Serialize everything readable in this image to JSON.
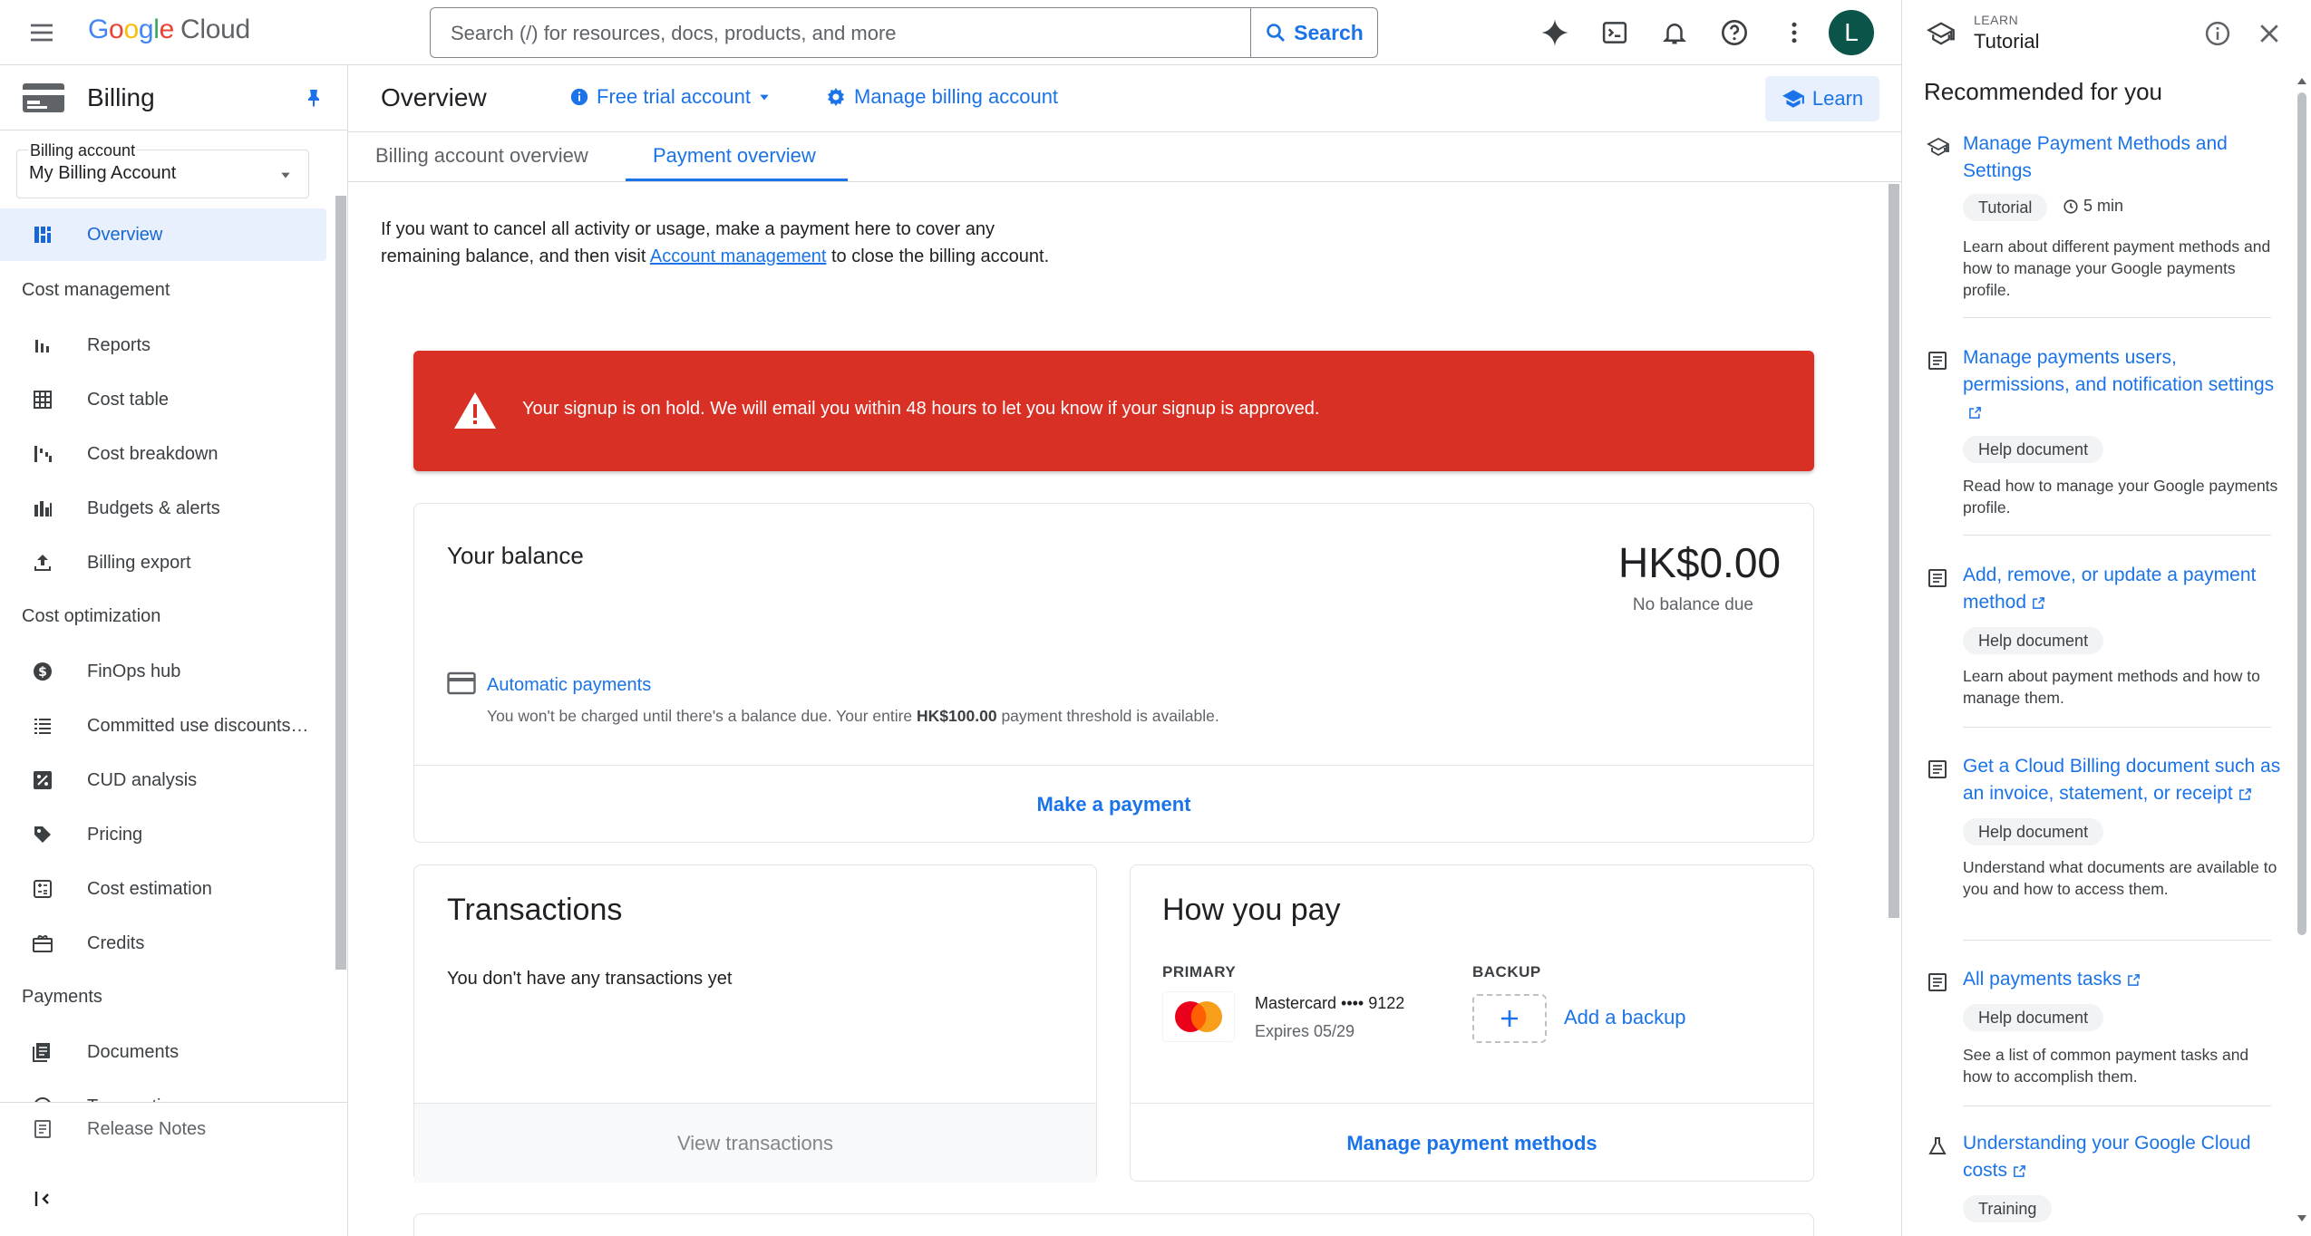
{
  "topbar": {
    "logo_google": "Google",
    "logo_cloud": "Cloud",
    "search_placeholder": "Search (/) for resources, docs, products, and more",
    "search_button": "Search",
    "avatar_initial": "L"
  },
  "billing_nav": {
    "title": "Billing",
    "account_label": "Billing account",
    "account_value": "My Billing Account",
    "overview": "Overview",
    "cost_management_heading": "Cost management",
    "cost_management": [
      "Reports",
      "Cost table",
      "Cost breakdown",
      "Budgets & alerts",
      "Billing export"
    ],
    "cost_optimization_heading": "Cost optimization",
    "cost_optimization": [
      "FinOps hub",
      "Committed use discounts…",
      "CUD analysis",
      "Pricing",
      "Cost estimation",
      "Credits"
    ],
    "payments_heading": "Payments",
    "payments": [
      "Documents",
      "Transactions"
    ],
    "release_notes": "Release Notes"
  },
  "page_header": {
    "title": "Overview",
    "account_type": "Free trial account",
    "manage_billing": "Manage billing account",
    "learn": "Learn"
  },
  "tabs": [
    "Billing account overview",
    "Payment overview"
  ],
  "intro": {
    "before_link": "If you want to cancel all activity or usage, make a payment here to cover any remaining balance, and then visit ",
    "link": "Account management",
    "after_link": " to close the billing account."
  },
  "alert": {
    "message": "Your signup is on hold. We will email you within 48 hours to let you know if your signup is approved."
  },
  "balance": {
    "title": "Your balance",
    "amount": "HK$0.00",
    "status": "No balance due",
    "autopay_link": "Automatic payments",
    "autopay_desc_before": "You won't be charged until there's a balance due. Your entire ",
    "autopay_threshold": "HK$100.00",
    "autopay_desc_after": " payment threshold is available.",
    "make_payment": "Make a payment"
  },
  "transactions": {
    "title": "Transactions",
    "empty": "You don't have any transactions yet",
    "view": "View transactions"
  },
  "how_you_pay": {
    "title": "How you pay",
    "primary_label": "PRIMARY",
    "backup_label": "BACKUP",
    "card_name": "Mastercard •••• 9122",
    "card_expiry": "Expires 05/29",
    "add_backup": "Add a backup",
    "manage": "Manage payment methods"
  },
  "learn_panel": {
    "eyebrow": "LEARN",
    "title": "Tutorial",
    "heading": "Recommended for you",
    "items": [
      {
        "title": "Manage Payment Methods and Settings",
        "type": "Tutorial",
        "duration": "5 min",
        "desc": "Learn about different payment methods and how to manage your Google payments profile.",
        "icon": "tutorial-cap-icon",
        "external": false
      },
      {
        "title": "Manage payments users, permissions, and notification settings",
        "type": "Help document",
        "desc": "Read how to manage your Google payments profile.",
        "icon": "document-icon",
        "external": true
      },
      {
        "title": "Add, remove, or update a payment method",
        "type": "Help document",
        "desc": "Learn about payment methods and how to manage them.",
        "icon": "document-icon",
        "external": true
      },
      {
        "title": "Get a Cloud Billing document such as an invoice, statement, or receipt",
        "type": "Help document",
        "desc": "Understand what documents are available to you and how to access them.",
        "icon": "document-icon",
        "external": true
      },
      {
        "title": "All payments tasks",
        "type": "Help document",
        "desc": "See a list of common payment tasks and how to accomplish them.",
        "icon": "document-icon",
        "external": true
      },
      {
        "title": "Understanding your Google Cloud costs",
        "type": "Training",
        "icon": "flask-icon",
        "external": true
      }
    ]
  },
  "colors": {
    "accent": "#1a73e8",
    "alert": "#d93025",
    "avatar": "#0b5449",
    "active_nav_bg": "#e8f0fe"
  }
}
